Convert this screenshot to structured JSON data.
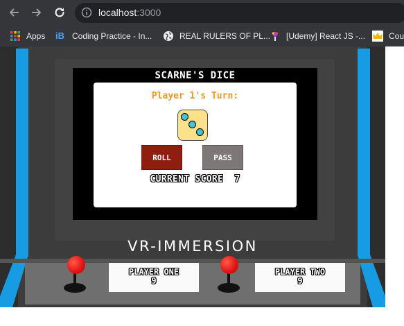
{
  "browser": {
    "url_host": "localhost",
    "url_port": ":3000",
    "bookmarks": [
      {
        "label": "Apps",
        "icon": "apps-grid-icon"
      },
      {
        "label": "Coding Practice - In...",
        "icon": "ib-icon"
      },
      {
        "label": "REAL RULERS OF PL...",
        "icon": "globe-icon"
      },
      {
        "label": "[Udemy] React JS -...",
        "icon": "udemy-icon"
      },
      {
        "label": "Cou",
        "icon": "crown-icon"
      }
    ]
  },
  "game": {
    "title": "SCARNE'S DICE",
    "turn_label": "Player 1's Turn:",
    "die_value": 3,
    "roll_label": "ROLL",
    "pass_label": "PASS",
    "current_score": "CURRENT SCORE  7"
  },
  "brand": "VR-IMMERSION",
  "players": [
    {
      "name": "PLAYER ONE",
      "score": "9"
    },
    {
      "name": "PLAYER TWO",
      "score": "9"
    }
  ],
  "colors": {
    "toolbar": "#35363a",
    "accent_blue": "#179be3",
    "turn_text": "#f0961e",
    "roll_button": "#8f1d10",
    "pass_button": "#7d7777",
    "die_face": "#fbe18a",
    "pip": "#4bc0cf",
    "joystick_ball": "#e01212"
  }
}
